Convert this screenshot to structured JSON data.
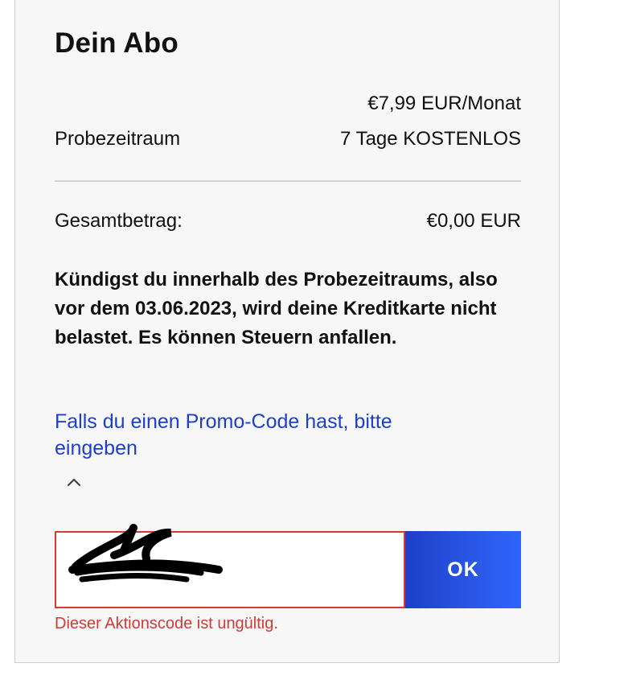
{
  "subscription": {
    "title": "Dein Abo",
    "price": "€7,99 EUR/Monat",
    "trial_label": "Probezeitraum",
    "trial_value": "7 Tage KOSTENLOS",
    "total_label": "Gesamtbetrag:",
    "total_value": "€0,00 EUR",
    "notice": "Kündigst du innerhalb des Probezeitraums, also vor dem 03.06.2023, wird deine Kreditkarte nicht belastet. Es können Steuern anfallen."
  },
  "promo": {
    "link_text": "Falls du einen Promo-Code hast, bitte eingeben",
    "input_value": "",
    "button_label": "OK",
    "error_text": "Dieser Aktionscode ist ungültig.",
    "chevron_icon": "chevron-up-icon"
  },
  "colors": {
    "link": "#1d3fcf",
    "error": "#d33a32",
    "button": "#2a58e6"
  }
}
